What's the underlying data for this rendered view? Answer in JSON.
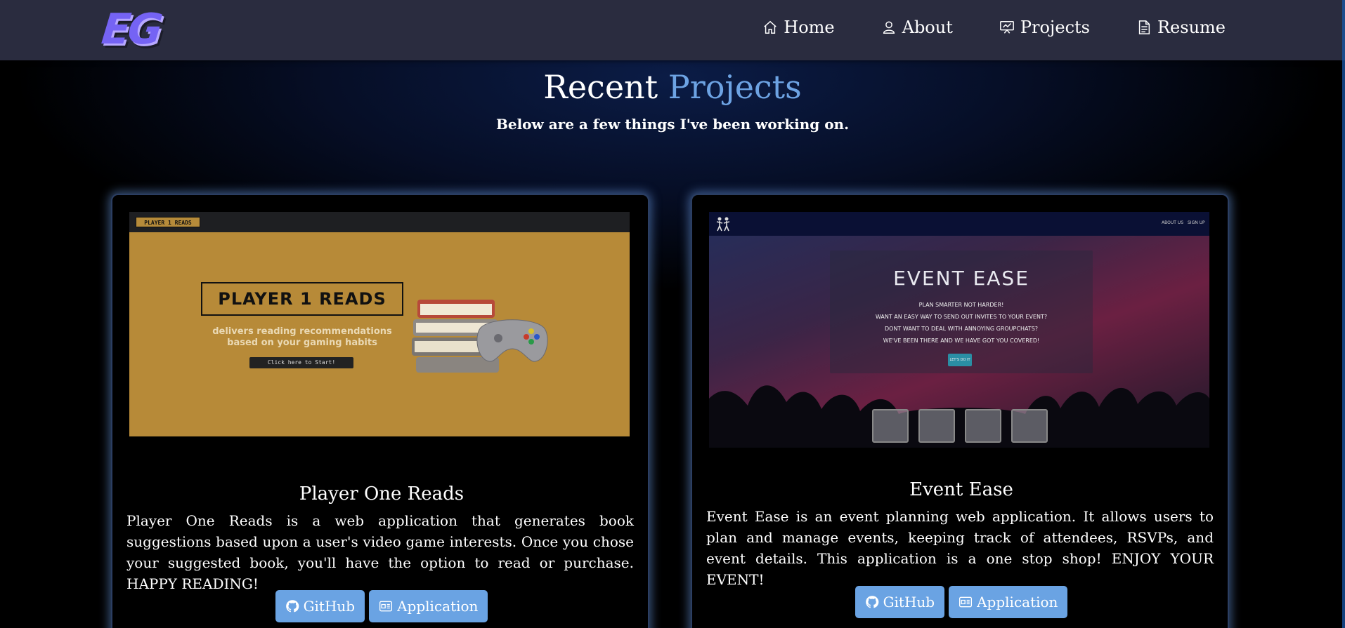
{
  "navbar": {
    "logo_text": "EG",
    "links": [
      {
        "label": "Home",
        "icon": "home-icon"
      },
      {
        "label": "About",
        "icon": "user-icon"
      },
      {
        "label": "Projects",
        "icon": "presentation-icon"
      },
      {
        "label": "Resume",
        "icon": "document-icon"
      }
    ]
  },
  "header": {
    "title_main": "Recent",
    "title_accent": "Projects",
    "subtitle": "Below are a few things I've been working on."
  },
  "projects": [
    {
      "title": "Player One Reads",
      "description": "Player One Reads is a web application that generates book suggestions based upon a user's video game interests. Once you chose your suggested book, you'll have the option to read or purchase. HAPPY READING!",
      "github_label": "GitHub",
      "app_label": "Application",
      "screenshot": {
        "small_logo": "PLAYER 1 READS",
        "logo": "PLAYER 1 READS",
        "tagline": "delivers reading recommendations based on your gaming habits",
        "start_button": "Click here to Start!"
      }
    },
    {
      "title": "Event Ease",
      "description": "Event Ease is an event planning web application. It allows users to plan and manage events, keeping track of attendees, RSVPs, and event details. This application is a one stop shop! ENJOY YOUR EVENT!",
      "github_label": "GitHub",
      "app_label": "Application",
      "screenshot": {
        "nav_about": "ABOUT US",
        "nav_signup": "SIGN UP",
        "title": "EVENT EASE",
        "lines": [
          "PLAN SMARTER NOT HARDER!",
          "WANT AN EASY WAY TO SEND OUT INVITES TO YOUR EVENT?",
          "DONT WANT TO DEAL WITH ANNOYING GROUPCHATS?",
          "WE'VE BEEN THERE AND WE HAVE GOT YOU COVERED!"
        ],
        "cta": "LET'S DO IT"
      }
    }
  ],
  "colors": {
    "navbar_bg": "#2a2c3f",
    "accent_blue": "#6da3e3",
    "logo_purple": "#7563f4",
    "button_bg": "#6aa3e3"
  }
}
